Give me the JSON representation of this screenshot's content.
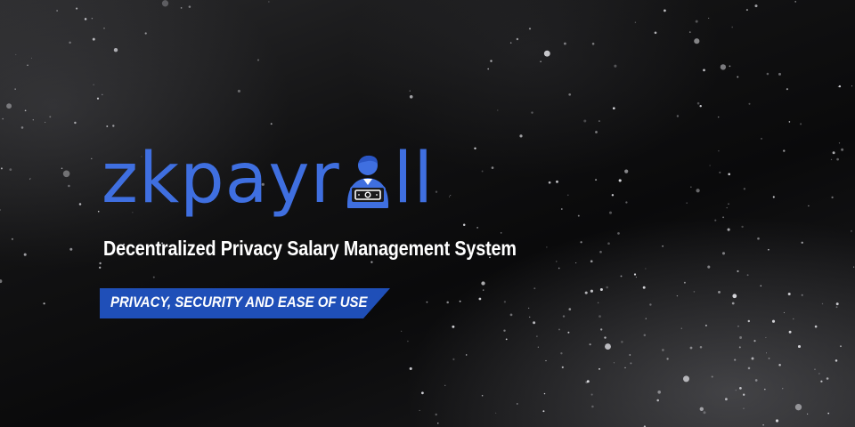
{
  "logo": {
    "text_before_icon": "zkpayr",
    "text_after_icon": "ll",
    "icon": "person-with-cash-icon",
    "color": "#3f6fe0"
  },
  "tagline": "Decentralized Privacy Salary Management System",
  "ribbon": {
    "label": "PRIVACY, SECURITY AND EASE OF USE",
    "color": "#1f4fb8"
  }
}
